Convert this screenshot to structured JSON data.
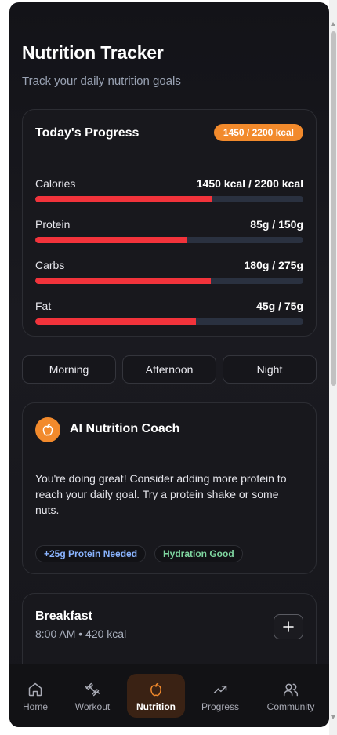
{
  "header": {
    "title": "Nutrition Tracker",
    "subtitle": "Track your daily nutrition goals"
  },
  "progress": {
    "title": "Today's Progress",
    "badge": "1450 / 2200 kcal",
    "metrics": [
      {
        "label": "Calories",
        "value": "1450 kcal / 2200 kcal",
        "fraction": 0.659
      },
      {
        "label": "Protein",
        "value": "85g / 150g",
        "fraction": 0.567
      },
      {
        "label": "Carbs",
        "value": "180g / 275g",
        "fraction": 0.655
      },
      {
        "label": "Fat",
        "value": "45g / 75g",
        "fraction": 0.6
      }
    ]
  },
  "times": [
    "Morning",
    "Afternoon",
    "Night"
  ],
  "coach": {
    "icon": "apple-icon",
    "title": "AI Nutrition Coach",
    "message": "You're doing great! Consider adding more protein to reach your daily goal. Try a protein shake or some nuts.",
    "tags": [
      "+25g Protein Needed",
      "Hydration Good"
    ]
  },
  "meal": {
    "title": "Breakfast",
    "subtitle": "8:00 AM • 420 kcal",
    "add_icon": "plus-icon"
  },
  "nav": [
    {
      "label": "Home",
      "icon": "home-icon"
    },
    {
      "label": "Workout",
      "icon": "dumbbell-icon"
    },
    {
      "label": "Nutrition",
      "icon": "apple-icon",
      "active": true
    },
    {
      "label": "Progress",
      "icon": "trending-up-icon"
    },
    {
      "label": "Community",
      "icon": "users-icon"
    }
  ],
  "colors": {
    "accent": "#f28a2c",
    "bar_fill": "#f2333b",
    "bar_track": "#2a3140",
    "background": "#15151a"
  }
}
